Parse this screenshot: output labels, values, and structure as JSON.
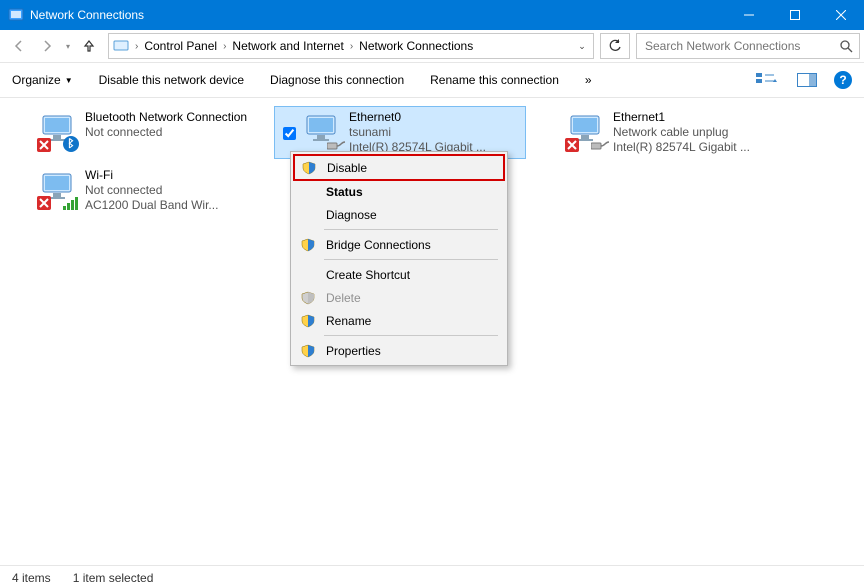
{
  "titlebar": {
    "title": "Network Connections"
  },
  "breadcrumbs": {
    "items": [
      "Control Panel",
      "Network and Internet",
      "Network Connections"
    ]
  },
  "search": {
    "placeholder": "Search Network Connections"
  },
  "commands": {
    "organize": "Organize",
    "disable": "Disable this network device",
    "diagnose": "Diagnose this connection",
    "rename": "Rename this connection",
    "overflow": "»"
  },
  "connections": [
    {
      "name": "Bluetooth Network Connection",
      "status": "Not connected",
      "device": "",
      "icon": "bluetooth",
      "error": true,
      "selected": false
    },
    {
      "name": "Wi-Fi",
      "status": "Not connected",
      "device": "AC1200  Dual Band Wir...",
      "icon": "wifi",
      "error": true,
      "selected": false
    },
    {
      "name": "Ethernet0",
      "status": "tsunami",
      "device": "Intel(R) 82574L Gigabit ...",
      "icon": "ethernet",
      "error": false,
      "selected": true
    },
    {
      "name": "Ethernet1",
      "status": "Network cable unplug",
      "device": "Intel(R) 82574L Gigabit ...",
      "icon": "ethernet",
      "error": true,
      "selected": false
    }
  ],
  "context_menu": {
    "items": [
      {
        "label": "Disable",
        "shield": true,
        "highlight": true
      },
      {
        "label": "Status",
        "bold": true
      },
      {
        "label": "Diagnose"
      },
      {
        "sep": true
      },
      {
        "label": "Bridge Connections",
        "shield": true
      },
      {
        "sep": true
      },
      {
        "label": "Create Shortcut"
      },
      {
        "label": "Delete",
        "shield": true,
        "disabled": true
      },
      {
        "label": "Rename",
        "shield": true
      },
      {
        "sep": true
      },
      {
        "label": "Properties",
        "shield": true
      }
    ]
  },
  "statusbar": {
    "count": "4 items",
    "selection": "1 item selected"
  }
}
